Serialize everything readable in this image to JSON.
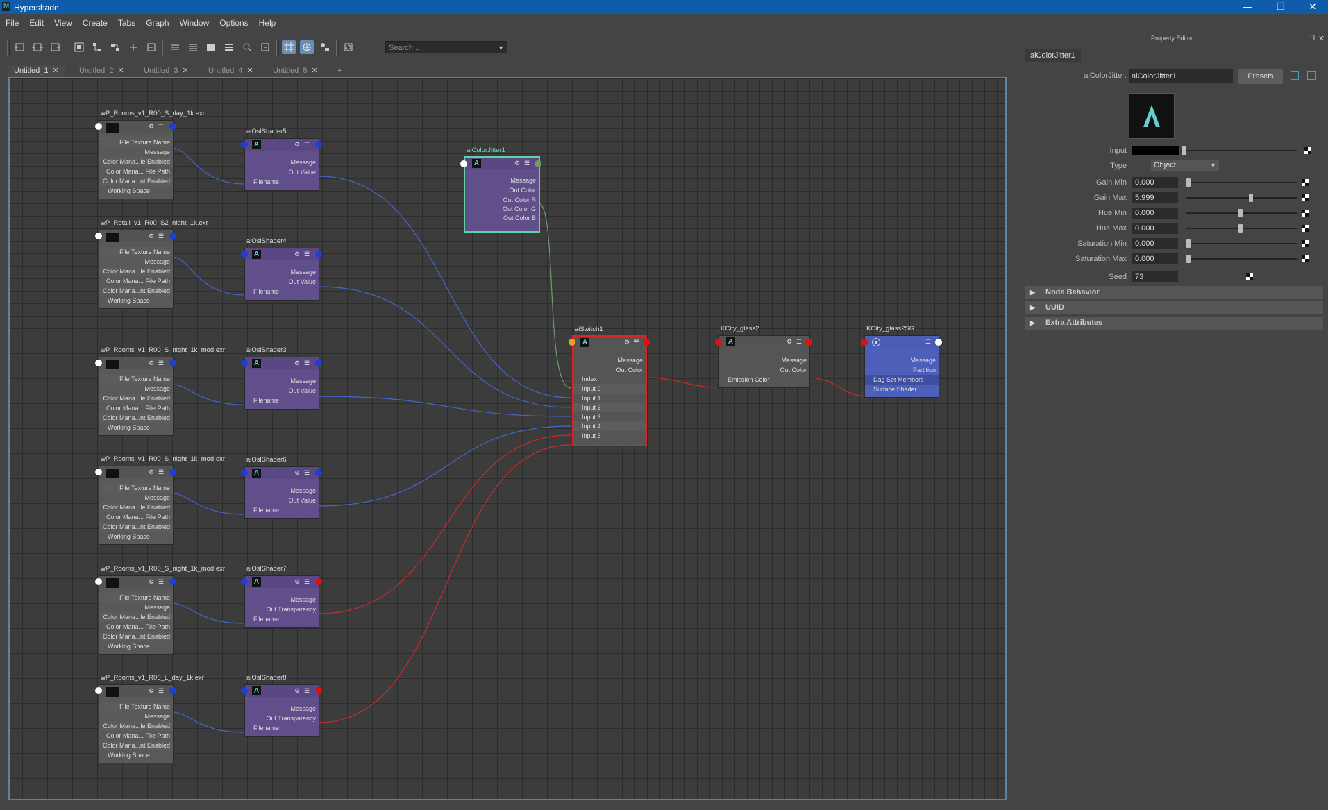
{
  "window": {
    "title": "Hypershade",
    "app_icon": "M"
  },
  "menu": [
    "File",
    "Edit",
    "View",
    "Create",
    "Tabs",
    "Graph",
    "Window",
    "Options",
    "Help"
  ],
  "search": {
    "placeholder": "Search..."
  },
  "tabs": [
    {
      "label": "Untitled_1"
    },
    {
      "label": "Untitled_2"
    },
    {
      "label": "Untitled_3"
    },
    {
      "label": "Untitled_4"
    },
    {
      "label": "Untitled_5"
    }
  ],
  "tab_add": "+",
  "file_nodes": [
    {
      "name": "wP_Rooms_v1_R00_S_day_1k.exr"
    },
    {
      "name": "wP_Retail_v1_R00_S2_night_1k.exr"
    },
    {
      "name": "wP_Rooms_v1_R00_S_night_1k_mod.exr"
    },
    {
      "name": "wP_Rooms_v1_R00_S_night_1k_mod.exr"
    },
    {
      "name": "wP_Rooms_v1_R00_S_night_1k_mod.exr"
    },
    {
      "name": "wP_Rooms_v1_R00_L_day_1k.exr"
    }
  ],
  "file_node_attrs": [
    "File Texture Name",
    "Message",
    "Color Mana...le Enabled",
    "Color Mana... File Path",
    "Color Mana...nt Enabled",
    "Working Space"
  ],
  "osl_nodes": [
    {
      "name": "aiOslShader5",
      "out": "Out Value"
    },
    {
      "name": "aiOslShader4",
      "out": "Out Value"
    },
    {
      "name": "aiOslShader3",
      "out": "Out Value"
    },
    {
      "name": "aiOslShader6",
      "out": "Out Value"
    },
    {
      "name": "aiOslShader7",
      "out": "Out Transparency"
    },
    {
      "name": "aiOslShader8",
      "out": "Out Transparency"
    }
  ],
  "osl_attrs": {
    "message": "Message",
    "filename": "Filename"
  },
  "color_jitter_node": {
    "name": "aiColorJitter1",
    "attrs": [
      "Message",
      "Out Color",
      "Out Color R",
      "Out Color G",
      "Out Color B"
    ]
  },
  "switch_node": {
    "name": "aiSwitch1",
    "attrs": [
      "Message",
      "Out Color",
      "Index",
      "Input 0",
      "Input 1",
      "Input 2",
      "Input 3",
      "Input 4",
      "Input 5"
    ]
  },
  "glass_node": {
    "name": "KCity_glass2",
    "attrs": [
      "Message",
      "Out Color",
      "Emission Color"
    ]
  },
  "sg_node": {
    "name": "KCity_glass2SG",
    "attrs": [
      "Message",
      "Partition",
      "Dag Set Members",
      "Surface Shader"
    ]
  },
  "property_editor": {
    "title": "Property Editor",
    "tab": "aiColorJitter1",
    "node_type_label": "aiColorJitter:",
    "node_name": "aiColorJitter1",
    "presets": "Presets",
    "input_label": "Input",
    "type_label": "Type",
    "type_value": "Object",
    "attributes": [
      {
        "label": "Gain Min",
        "value": "0.000",
        "slider": 0.0
      },
      {
        "label": "Gain Max",
        "value": "5.999",
        "slider": 0.6
      },
      {
        "label": "Hue Min",
        "value": "0.000",
        "slider": 0.5
      },
      {
        "label": "Hue Max",
        "value": "0.000",
        "slider": 0.5
      },
      {
        "label": "Saturation Min",
        "value": "0.000",
        "slider": 0.0
      },
      {
        "label": "Saturation Max",
        "value": "0.000",
        "slider": 0.0
      }
    ],
    "seed_label": "Seed",
    "seed_value": "73",
    "sections": [
      "Node Behavior",
      "UUID",
      "Extra Attributes"
    ]
  }
}
